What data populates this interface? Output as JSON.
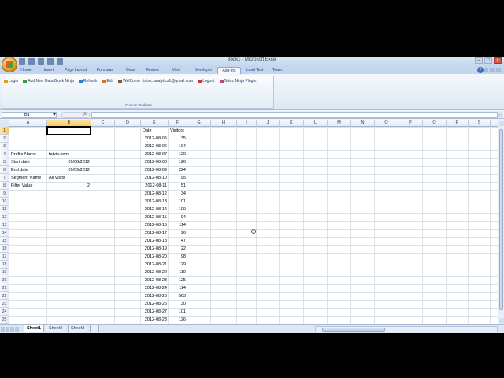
{
  "window": {
    "title": "Book1 - Microsoft Excel",
    "controls": [
      "–",
      "□",
      "×"
    ]
  },
  "ribbon": {
    "tabs": [
      {
        "label": "Home",
        "active": false
      },
      {
        "label": "Insert",
        "active": false
      },
      {
        "label": "Page Layout",
        "active": false
      },
      {
        "label": "Formulas",
        "active": false
      },
      {
        "label": "Data",
        "active": false
      },
      {
        "label": "Review",
        "active": false
      },
      {
        "label": "View",
        "active": false
      },
      {
        "label": "Developer",
        "active": false
      },
      {
        "label": "Add-Ins",
        "active": true
      },
      {
        "label": "Load Test",
        "active": false
      },
      {
        "label": "Team",
        "active": false
      }
    ],
    "custom_toolbar": {
      "items": [
        {
          "label": "Login",
          "icon": "key-icon",
          "color": "#d9a21b"
        },
        {
          "label": "Add New Data Block Ninja",
          "icon": "add-icon",
          "color": "#3a9b3a"
        },
        {
          "label": "Refresh",
          "icon": "refresh-icon",
          "color": "#2f7bd0"
        },
        {
          "label": "Edit",
          "icon": "edit-icon",
          "color": "#c8792a"
        },
        {
          "label": "WelCome : tatvic.analytics1@gmail.com",
          "icon": "user-icon",
          "color": "#7a5a3a"
        },
        {
          "label": "Logout",
          "icon": "logout-icon",
          "color": "#c23b3b"
        },
        {
          "label": "Tatvic Ninja Plugin",
          "icon": "ninja-icon",
          "color": "#c0408a"
        }
      ],
      "group_label": "Custom Toolbars"
    }
  },
  "formula_bar": {
    "name_box": "B1",
    "fx": "fx",
    "formula": ""
  },
  "grid": {
    "columns": [
      "A",
      "B",
      "C",
      "D",
      "E",
      "F",
      "G",
      "H",
      "I",
      "J",
      "K",
      "L",
      "M",
      "N",
      "O",
      "P",
      "Q",
      "R",
      "S"
    ],
    "rows": [
      "1",
      "2",
      "3",
      "4",
      "5",
      "6",
      "7",
      "8",
      "9",
      "10",
      "11",
      "12",
      "13",
      "14",
      "15",
      "16",
      "17",
      "18",
      "19",
      "20",
      "21",
      "22",
      "23",
      "24",
      "25"
    ],
    "selected_cell": "B1",
    "profile_block": [
      {
        "row": 4,
        "label": "Profile Name",
        "value": "tatvic.com",
        "align": "left"
      },
      {
        "row": 5,
        "label": "Start date",
        "value": "05/08/2012",
        "align": "right"
      },
      {
        "row": 6,
        "label": "End date",
        "value": "05/09/2012",
        "align": "right"
      },
      {
        "row": 7,
        "label": "Segment Name",
        "value": "All Visits",
        "align": "left"
      },
      {
        "row": 8,
        "label": "Filter Value",
        "value": "2",
        "align": "right"
      }
    ],
    "data_headers": {
      "date": "Date",
      "visitors": "Visitors"
    },
    "data_rows": [
      {
        "date": "2012-08-05",
        "visitors": "35"
      },
      {
        "date": "2012-08-06",
        "visitors": "104"
      },
      {
        "date": "2012-08-07",
        "visitors": "120"
      },
      {
        "date": "2012-08-08",
        "visitors": "126"
      },
      {
        "date": "2012-08-09",
        "visitors": "224"
      },
      {
        "date": "2012-08-10",
        "visitors": "95"
      },
      {
        "date": "2012-08-11",
        "visitors": "51"
      },
      {
        "date": "2012-08-12",
        "visitors": "34"
      },
      {
        "date": "2012-08-13",
        "visitors": "101"
      },
      {
        "date": "2012-08-14",
        "visitors": "100"
      },
      {
        "date": "2012-08-15",
        "visitors": "94"
      },
      {
        "date": "2012-08-16",
        "visitors": "114"
      },
      {
        "date": "2012-08-17",
        "visitors": "96"
      },
      {
        "date": "2012-08-18",
        "visitors": "47"
      },
      {
        "date": "2012-08-19",
        "visitors": "22"
      },
      {
        "date": "2012-08-20",
        "visitors": "98"
      },
      {
        "date": "2012-08-21",
        "visitors": "129"
      },
      {
        "date": "2012-08-22",
        "visitors": "110"
      },
      {
        "date": "2012-08-23",
        "visitors": "125"
      },
      {
        "date": "2012-08-24",
        "visitors": "114"
      },
      {
        "date": "2012-08-25",
        "visitors": "563"
      },
      {
        "date": "2012-08-26",
        "visitors": "30"
      },
      {
        "date": "2012-08-27",
        "visitors": "101"
      },
      {
        "date": "2012-08-28",
        "visitors": "126"
      }
    ]
  },
  "sheets": [
    {
      "label": "Sheet1",
      "active": true
    },
    {
      "label": "Sheet2",
      "active": false
    },
    {
      "label": "Sheet3",
      "active": false
    }
  ]
}
